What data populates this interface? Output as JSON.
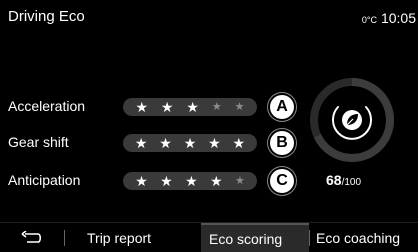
{
  "header": {
    "title": "Driving Eco",
    "temperature": "0°C",
    "time": "10:05"
  },
  "criteria": [
    {
      "label": "Acceleration",
      "marker": "A",
      "stars_on": 3,
      "stars_total": 5
    },
    {
      "label": "Gear shift",
      "marker": "B",
      "stars_on": 5,
      "stars_total": 5
    },
    {
      "label": "Anticipation",
      "marker": "C",
      "stars_on": 4,
      "stars_total": 5
    }
  ],
  "gauge": {
    "score": "68",
    "max": "/100",
    "icon": "leaf-icon",
    "fraction": 0.68
  },
  "footer": {
    "back_icon": "back-arrow-icon",
    "tabs": [
      {
        "label": "Trip report"
      },
      {
        "label": "Eco scoring"
      },
      {
        "label": "Eco coaching"
      }
    ]
  },
  "colors": {
    "background": "#000000",
    "rating_track": "#3a3a3a",
    "star_off": "#8c8c8c",
    "star_on": "#ffffff"
  }
}
